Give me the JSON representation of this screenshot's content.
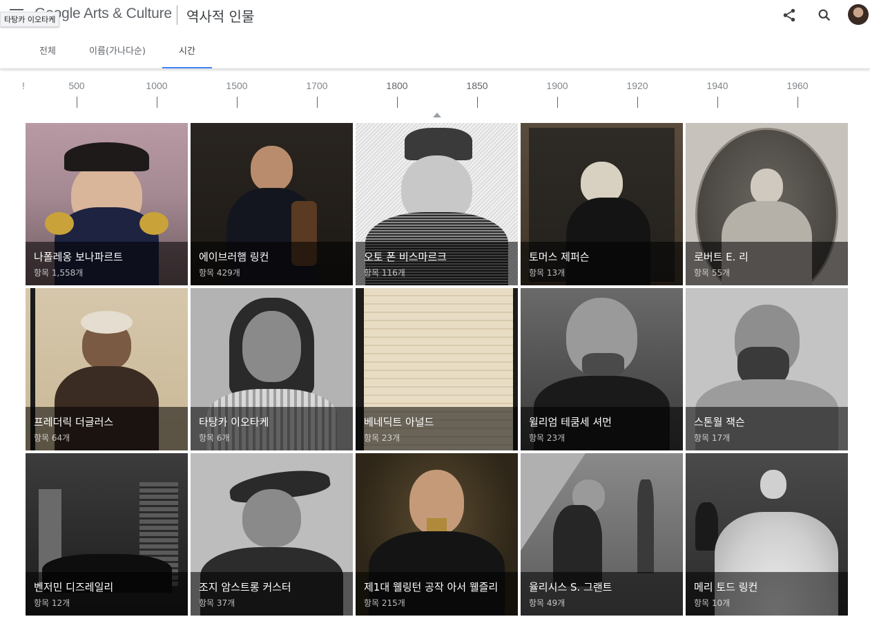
{
  "header": {
    "logo": "Google Arts & Culture",
    "title": "역사적 인물",
    "tooltip": "타탕카 이오타케"
  },
  "tabs": [
    {
      "label": "전체"
    },
    {
      "label": "이름(가나다순)"
    },
    {
      "label": "시간",
      "active": true
    }
  ],
  "timeline": {
    "start_mark": "!",
    "ticks": [
      "500",
      "1000",
      "1500",
      "1700",
      "1800",
      "1850",
      "1900",
      "1920",
      "1940",
      "1960"
    ],
    "strong_ticks": [
      "1800",
      "1850"
    ]
  },
  "cards": [
    {
      "name": "나폴레옹 보나파르트",
      "count": "항목 1,558개"
    },
    {
      "name": "에이브러햄 링컨",
      "count": "항목 429개"
    },
    {
      "name": "오토 폰 비스마르크",
      "count": "항목 116개"
    },
    {
      "name": "토머스 제퍼슨",
      "count": "항목 13개"
    },
    {
      "name": "로버트 E. 리",
      "count": "항목 55개"
    },
    {
      "name": "프레더릭 더글러스",
      "count": "항목 64개"
    },
    {
      "name": "타탕카 이오타케",
      "count": "항목 6개"
    },
    {
      "name": "베네딕트 아널드",
      "count": "항목 23개"
    },
    {
      "name": "윌리엄 테쿰세 셔먼",
      "count": "항목 23개"
    },
    {
      "name": "스톤월 잭슨",
      "count": "항목 17개"
    },
    {
      "name": "벤저민 디즈레일리",
      "count": "항목 12개"
    },
    {
      "name": "조지 암스트롱 커스터",
      "count": "항목 37개"
    },
    {
      "name": "제1대 웰링턴 공작 아서 웰즐리",
      "count": "항목 215개"
    },
    {
      "name": "율리시스 S. 그랜트",
      "count": "항목 49개"
    },
    {
      "name": "메리 토드 링컨",
      "count": "항목 10개"
    }
  ],
  "icons": {
    "menu": "menu-icon",
    "share": "share-icon",
    "search": "search-icon",
    "avatar": "avatar"
  },
  "colors": {
    "accent": "#4285f4",
    "caption_overlay": "rgba(0,0,0,0.55)"
  }
}
